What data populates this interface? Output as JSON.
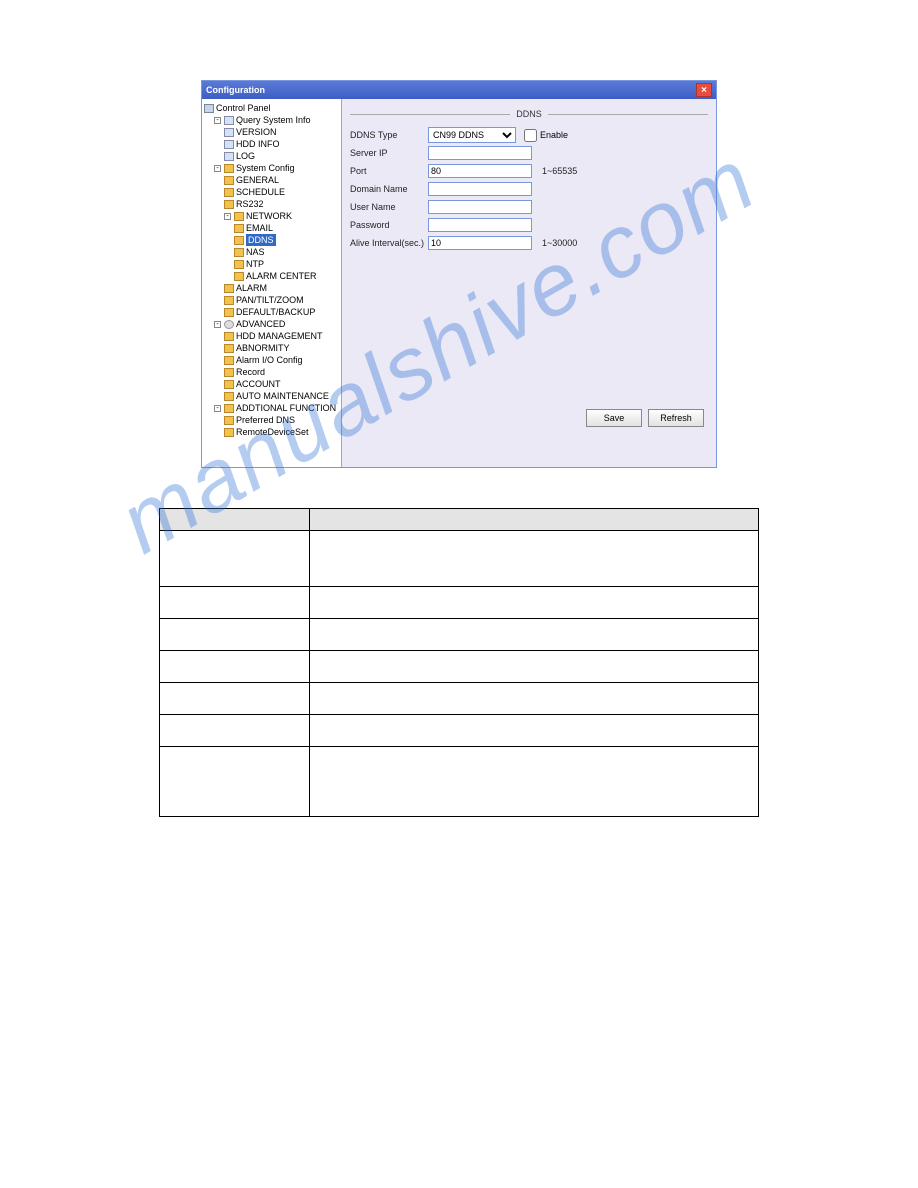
{
  "watermark": "manualshive.com",
  "window": {
    "title": "Configuration",
    "close_icon": "×",
    "section_title": "DDNS",
    "tree": {
      "root": "Control Panel",
      "node_query": "Query System Info",
      "leaf_version": "VERSION",
      "leaf_hdd": "HDD INFO",
      "leaf_log": "LOG",
      "node_syscfg": "System Config",
      "leaf_general": "GENERAL",
      "leaf_schedule": "SCHEDULE",
      "leaf_rs232": "RS232",
      "node_network": "NETWORK",
      "leaf_email": "EMAIL",
      "leaf_ddns": "DDNS",
      "leaf_nas": "NAS",
      "leaf_ntp": "NTP",
      "leaf_alarmc": "ALARM CENTER",
      "leaf_alarm": "ALARM",
      "leaf_ptz": "PAN/TILT/ZOOM",
      "leaf_defbk": "DEFAULT/BACKUP",
      "node_adv": "ADVANCED",
      "leaf_hddm": "HDD MANAGEMENT",
      "leaf_abn": "ABNORMITY",
      "leaf_aio": "Alarm I/O Config",
      "leaf_rec": "Record",
      "leaf_acct": "ACCOUNT",
      "leaf_auto": "AUTO MAINTENANCE",
      "node_addl": "ADDTIONAL FUNCTION",
      "leaf_pdns": "Preferred DNS",
      "leaf_rds": "RemoteDeviceSet"
    },
    "form": {
      "ddns_type_label": "DDNS Type",
      "ddns_type_value": "CN99 DDNS",
      "enable_label": "Enable",
      "server_ip_label": "Server IP",
      "server_ip_value": "",
      "port_label": "Port",
      "port_value": "80",
      "port_hint": "1~65535",
      "domain_label": "Domain Name",
      "domain_value": "",
      "user_label": "User Name",
      "user_value": "",
      "pwd_label": "Password",
      "pwd_value": "",
      "alive_label": "Alive Interval(sec.)",
      "alive_value": "10",
      "alive_hint": "1~30000"
    },
    "buttons": {
      "save": "Save",
      "refresh": "Refresh"
    }
  },
  "table": {
    "header_param": "",
    "header_func": "",
    "rows": [
      {
        "param": "",
        "func": ""
      },
      {
        "param": "",
        "func": ""
      },
      {
        "param": "",
        "func": ""
      },
      {
        "param": "",
        "func": ""
      },
      {
        "param": "",
        "func": ""
      },
      {
        "param": "",
        "func": ""
      },
      {
        "param": "",
        "func": ""
      }
    ]
  }
}
